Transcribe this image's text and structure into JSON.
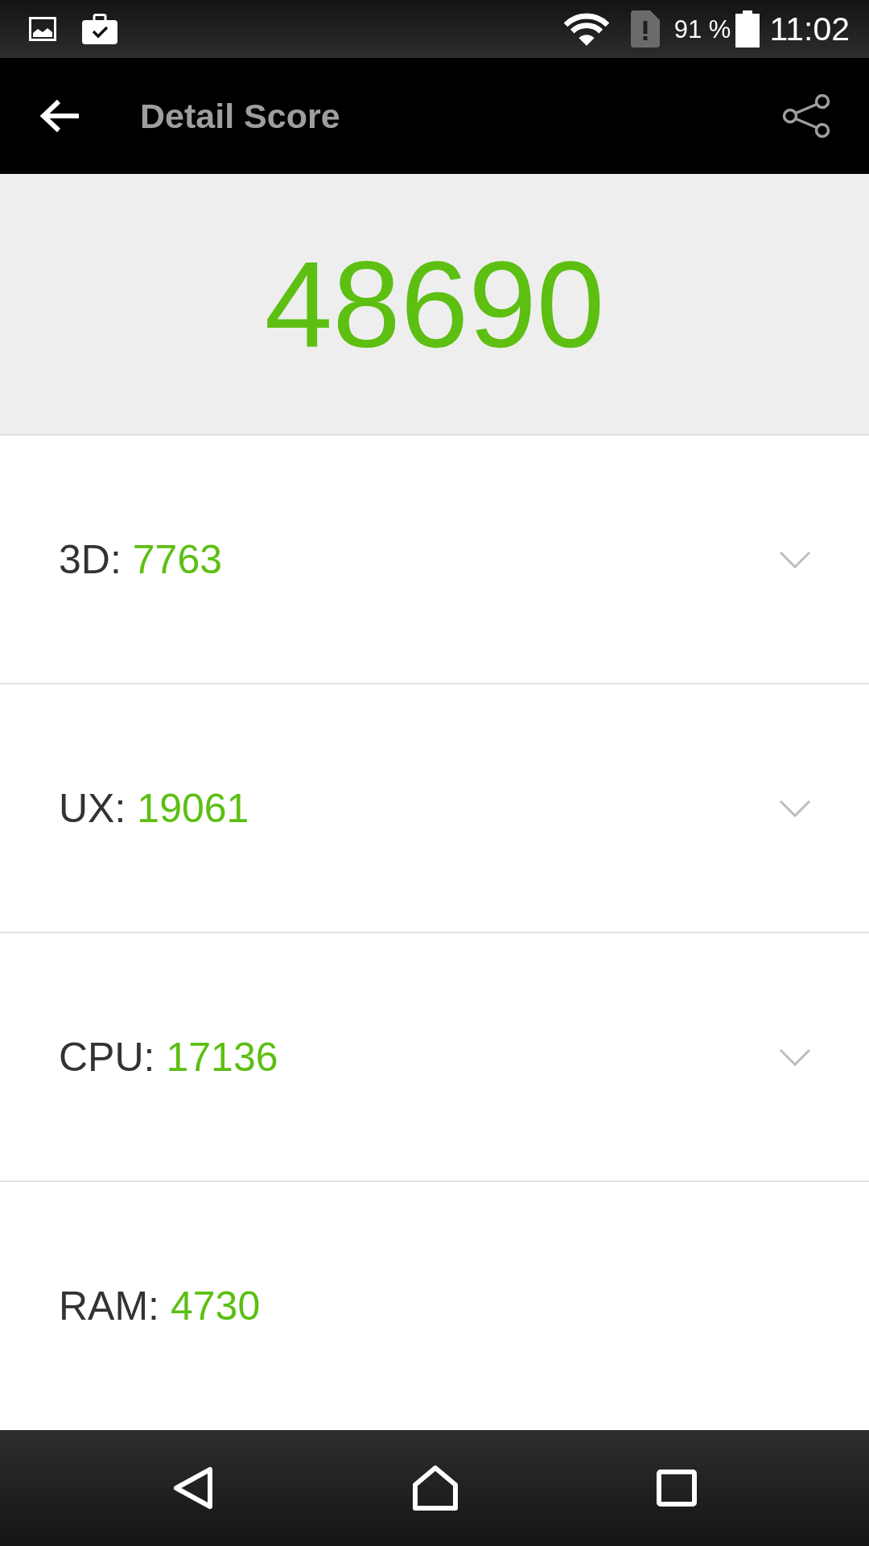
{
  "status_bar": {
    "battery": "91 %",
    "time": "11:02"
  },
  "app_bar": {
    "title": "Detail Score"
  },
  "total_score": "48690",
  "rows": [
    {
      "label": "3D:",
      "value": "7763",
      "expandable": true
    },
    {
      "label": "UX:",
      "value": "19061",
      "expandable": true
    },
    {
      "label": "CPU:",
      "value": "17136",
      "expandable": true
    },
    {
      "label": "RAM:",
      "value": "4730",
      "expandable": false
    }
  ]
}
